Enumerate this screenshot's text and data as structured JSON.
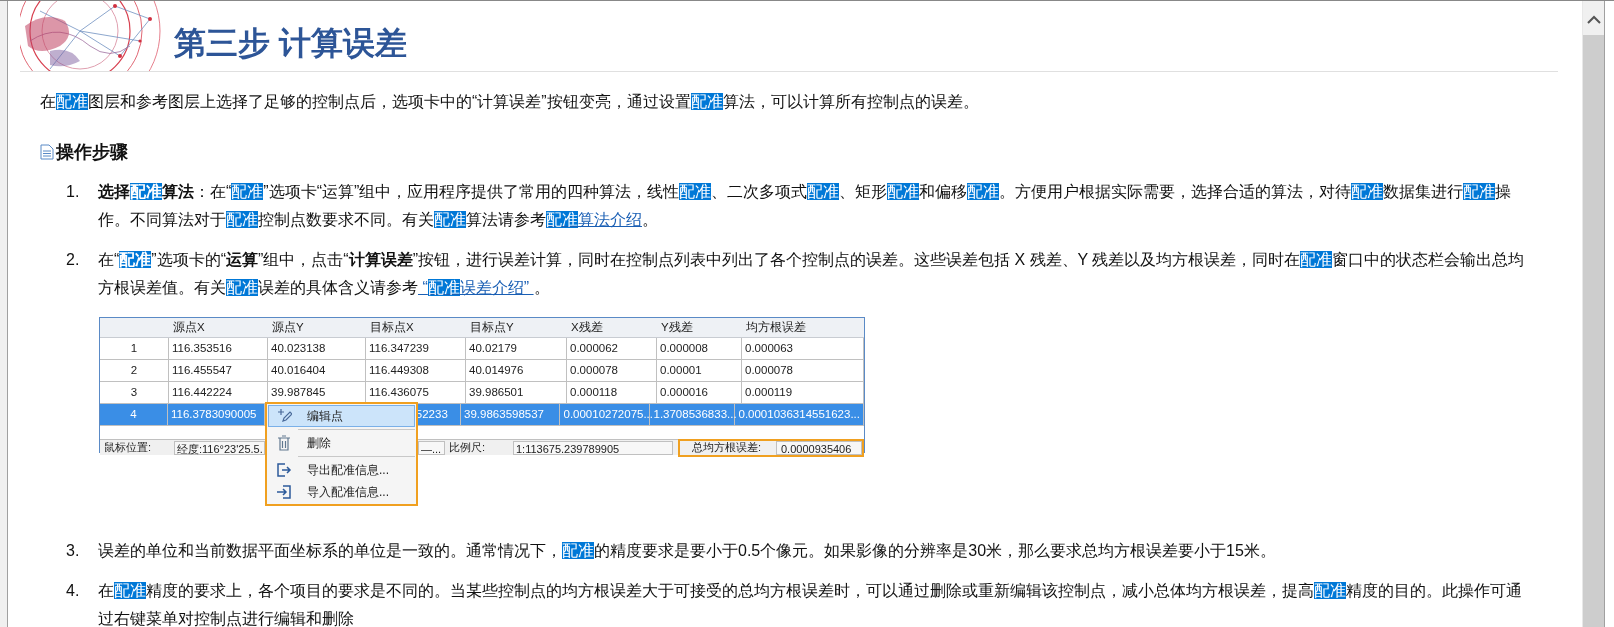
{
  "title": "第三步 计算误差",
  "intro": [
    {
      "kind": "plain",
      "text": "在"
    },
    {
      "kind": "mark",
      "text": "配准"
    },
    {
      "kind": "plain",
      "text": "图层和参考图层上选择了足够的控制点后，选项卡中的“计算误差”按钮变亮，通过设置"
    },
    {
      "kind": "mark",
      "text": "配准"
    },
    {
      "kind": "plain",
      "text": "算法，可以计算所有控制点的误差。"
    }
  ],
  "section_heading": "操作步骤",
  "steps": [
    {
      "number": "1.",
      "segments": [
        {
          "kind": "bold",
          "text": "选择"
        },
        {
          "kind": "boldmark",
          "text": "配准"
        },
        {
          "kind": "bold",
          "text": "算法"
        },
        {
          "kind": "plain",
          "text": "：在“"
        },
        {
          "kind": "mark",
          "text": "配准"
        },
        {
          "kind": "plain",
          "text": "”选项卡“运算”组中，应用程序提供了常用的四种算法，线性"
        },
        {
          "kind": "mark",
          "text": "配准"
        },
        {
          "kind": "plain",
          "text": "、二次多项式"
        },
        {
          "kind": "mark",
          "text": "配准"
        },
        {
          "kind": "plain",
          "text": "、矩形"
        },
        {
          "kind": "mark",
          "text": "配准"
        },
        {
          "kind": "plain",
          "text": "和偏移"
        },
        {
          "kind": "mark",
          "text": "配准"
        },
        {
          "kind": "plain",
          "text": "。方便用户根据实际需要，选择合适的算法，对待"
        },
        {
          "kind": "mark",
          "text": "配准"
        },
        {
          "kind": "plain",
          "text": "数据集进行"
        },
        {
          "kind": "mark",
          "text": "配准"
        },
        {
          "kind": "plain",
          "text": "操作。不同算法对于"
        },
        {
          "kind": "mark",
          "text": "配准"
        },
        {
          "kind": "plain",
          "text": "控制点数要求不同。有关"
        },
        {
          "kind": "mark",
          "text": "配准"
        },
        {
          "kind": "plain",
          "text": "算法请参考"
        },
        {
          "kind": "link",
          "parts": [
            {
              "kind": "mark",
              "text": "配准"
            },
            {
              "kind": "plain",
              "text": "算法介绍"
            }
          ]
        },
        {
          "kind": "plain",
          "text": "。"
        }
      ]
    },
    {
      "number": "2.",
      "segments": [
        {
          "kind": "plain",
          "text": "在“"
        },
        {
          "kind": "boldmark",
          "text": "配准"
        },
        {
          "kind": "plain",
          "text": "”选项卡的“"
        },
        {
          "kind": "bold",
          "text": "运算"
        },
        {
          "kind": "plain",
          "text": "”组中，点击“"
        },
        {
          "kind": "bold",
          "text": "计算误差"
        },
        {
          "kind": "plain",
          "text": "”按钮，进行误差计算，同时在控制点列表中列出了各个控制点的误差。这些误差包括 X 残差、Y 残差以及均方根误差，同时在"
        },
        {
          "kind": "mark",
          "text": "配准"
        },
        {
          "kind": "plain",
          "text": "窗口中的状态栏会输出总均方根误差值。有关"
        },
        {
          "kind": "mark",
          "text": "配准"
        },
        {
          "kind": "plain",
          "text": "误差的具体含义请参考"
        },
        {
          "kind": "link",
          "parts": [
            {
              "kind": "plain",
              "text": " “"
            },
            {
              "kind": "mark",
              "text": "配准"
            },
            {
              "kind": "plain",
              "text": "误差介绍” "
            }
          ]
        },
        {
          "kind": "plain",
          "text": "。"
        }
      ],
      "figure": {
        "columns": [
          "",
          "源点X",
          "源点Y",
          "目标点X",
          "目标点Y",
          "X残差",
          "Y残差",
          "均方根误差"
        ],
        "rows": [
          {
            "cells": [
              "1",
              "116.353516",
              "40.023138",
              "116.347239",
              "40.02179",
              "0.000062",
              "0.000008",
              "0.000063"
            ],
            "selected": false
          },
          {
            "cells": [
              "2",
              "116.455547",
              "40.016404",
              "116.449308",
              "40.014976",
              "0.000078",
              "0.00001",
              "0.000078"
            ],
            "selected": false
          },
          {
            "cells": [
              "3",
              "116.442224",
              "39.987845",
              "116.436075",
              "39.986501",
              "0.000118",
              "0.000016",
              "0.000119"
            ],
            "selected": false
          },
          {
            "cells": [
              "4",
              "116.3783090005",
              null,
              "52233",
              "39.9863598537",
              "0.00010272075...",
              "1.3708536833...",
              "0.0001036314551623..."
            ],
            "selected": true
          }
        ],
        "status_bar": [
          {
            "kind": "label",
            "text": "鼠标位置:"
          },
          {
            "kind": "field",
            "text": "经度:116°23'25.5."
          },
          {
            "kind": "field",
            "text": "—..."
          },
          {
            "kind": "label",
            "text": "比例尺:"
          },
          {
            "kind": "field",
            "text": "1:113675.239789905"
          }
        ],
        "callout": {
          "label": "总均方根误差:",
          "value": "0.0000935406"
        },
        "context_menu": [
          {
            "kind": "edit",
            "label": "编辑点",
            "selected": true,
            "separator_after": true
          },
          {
            "kind": "delete",
            "label": "删除",
            "selected": false,
            "separator_after": true
          },
          {
            "kind": "export",
            "label": "导出配准信息...",
            "selected": false,
            "separator_after": false
          },
          {
            "kind": "import",
            "label": "导入配准信息...",
            "selected": false,
            "separator_after": false
          }
        ]
      }
    },
    {
      "number": "3.",
      "segments": [
        {
          "kind": "plain",
          "text": "误差的单位和当前数据平面坐标系的单位是一致的。通常情况下，"
        },
        {
          "kind": "mark",
          "text": "配准"
        },
        {
          "kind": "plain",
          "text": "的精度要求是要小于0.5个像元。如果影像的分辨率是30米，那么要求总均方根误差要小于15米。"
        }
      ]
    },
    {
      "number": "4.",
      "segments": [
        {
          "kind": "plain",
          "text": "在"
        },
        {
          "kind": "mark",
          "text": "配准"
        },
        {
          "kind": "plain",
          "text": "精度的要求上，各个项目的要求是不同的。当某些控制点的均方根误差大于可接受的总均方根误差时，可以通过删除或重新编辑该控制点，减小总体均方根误差，提高"
        },
        {
          "kind": "mark",
          "text": "配准"
        },
        {
          "kind": "plain",
          "text": "精度的目的。此操作可通过右键菜单对控制点进行编辑和删除"
        }
      ]
    }
  ]
}
